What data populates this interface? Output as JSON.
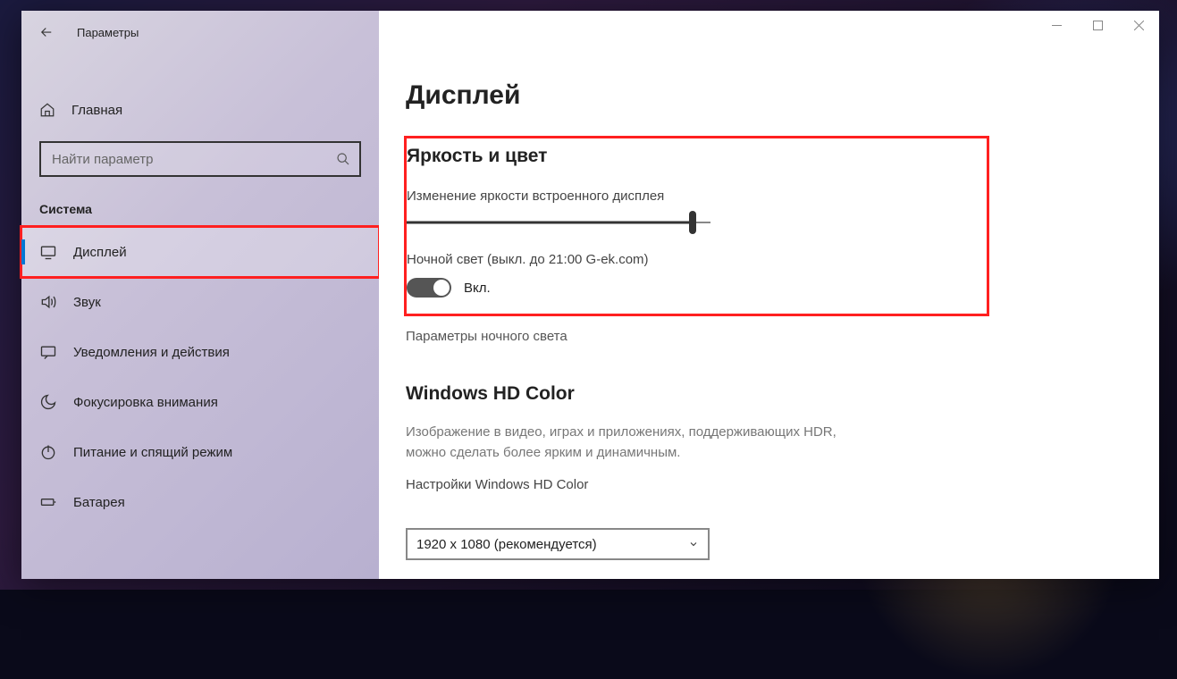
{
  "header": {
    "title": "Параметры"
  },
  "sidebar": {
    "home_label": "Главная",
    "search_placeholder": "Найти параметр",
    "category_label": "Система",
    "items": [
      {
        "id": "display",
        "label": "Дисплей",
        "icon": "monitor-icon",
        "active": true,
        "highlighted": true
      },
      {
        "id": "sound",
        "label": "Звук",
        "icon": "speaker-icon"
      },
      {
        "id": "notifications",
        "label": "Уведомления и действия",
        "icon": "chat-icon"
      },
      {
        "id": "focus",
        "label": "Фокусировка внимания",
        "icon": "moon-icon"
      },
      {
        "id": "power",
        "label": "Питание и спящий режим",
        "icon": "power-icon"
      },
      {
        "id": "battery",
        "label": "Батарея",
        "icon": "battery-icon"
      }
    ]
  },
  "main": {
    "page_title": "Дисплей",
    "brightness_section": {
      "title": "Яркость и цвет",
      "brightness_label": "Изменение яркости встроенного дисплея",
      "brightness_value": 94,
      "night_light_label": "Ночной свет (выкл. до 21:00 G-ek.com)",
      "toggle_state_label": "Вкл.",
      "night_light_settings_link": "Параметры ночного света"
    },
    "hd_color_section": {
      "title": "Windows HD Color",
      "description": "Изображение в видео, играх и приложениях, поддерживающих HDR, можно сделать более ярким и динамичным.",
      "settings_link": "Настройки Windows HD Color"
    },
    "resolution": {
      "selected": "1920 x 1080 (рекомендуется)"
    }
  }
}
